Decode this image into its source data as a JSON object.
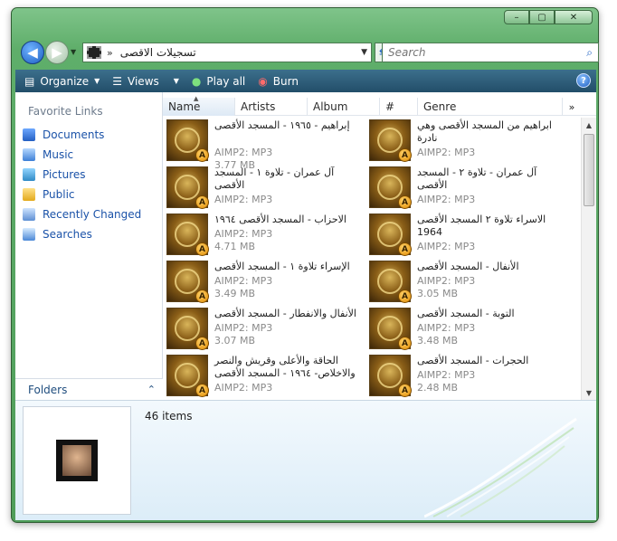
{
  "window": {
    "minimize_glyph": "–",
    "maximize_glyph": "▢",
    "close_glyph": "✕"
  },
  "address": {
    "separator": "»",
    "path": "تسجيلات الاقصى",
    "search_placeholder": "Search"
  },
  "toolbar": {
    "organize": "Organize",
    "views": "Views",
    "play_all": "Play all",
    "burn": "Burn",
    "help_glyph": "?"
  },
  "nav": {
    "favorite_title": "Favorite Links",
    "items": [
      {
        "label": "Documents",
        "icon": "documents-icon"
      },
      {
        "label": "Music",
        "icon": "music-icon"
      },
      {
        "label": "Pictures",
        "icon": "pictures-icon"
      },
      {
        "label": "Public",
        "icon": "public-icon"
      },
      {
        "label": "Recently Changed",
        "icon": "recently-changed-icon"
      },
      {
        "label": "Searches",
        "icon": "searches-icon"
      }
    ],
    "folders_label": "Folders"
  },
  "columns": {
    "name": "Name",
    "artists": "Artists",
    "album": "Album",
    "number": "#",
    "genre": "Genre",
    "more": "»"
  },
  "files": [
    {
      "title": "إبراهيم - ١٩٦٥ - المسجد الأقصى",
      "type": "AIMP2: MP3",
      "size": "3.77 MB"
    },
    {
      "title": "ابراهيم من المسجد الأقصى وهي نادرة",
      "type": "AIMP2: MP3",
      "size": ""
    },
    {
      "title": "آل عمران - تلاوة ١ - المسجد الأقصى",
      "type": "AIMP2: MP3",
      "size": ""
    },
    {
      "title": "آل عمران - تلاوة ٢ - المسجد الأقصى",
      "type": "AIMP2: MP3",
      "size": ""
    },
    {
      "title": "الاحزاب - المسجد الأقصى ١٩٦٤",
      "type": "AIMP2: MP3",
      "size": "4.71 MB"
    },
    {
      "title": "الاسراء تلاوة ٢ المسجد الأقصى 1964",
      "type": "AIMP2: MP3",
      "size": ""
    },
    {
      "title": "الإسراء تلاوة ١ - المسجد الأقصى",
      "type": "AIMP2: MP3",
      "size": "3.49 MB"
    },
    {
      "title": "الأنفال - المسجد الأقصى",
      "type": "AIMP2: MP3",
      "size": "3.05 MB"
    },
    {
      "title": "الأنفال والانفطار - المسجد الأقصى",
      "type": "AIMP2: MP3",
      "size": "3.07 MB"
    },
    {
      "title": "التوبة - المسجد الأقصى",
      "type": "AIMP2: MP3",
      "size": "3.48 MB"
    },
    {
      "title": "الحاقة والأعلى وقريش والنصر والاخلاص- ١٩٦٤ - المسجد الأقصى",
      "type": "AIMP2: MP3",
      "size": ""
    },
    {
      "title": "الحجرات - المسجد الأقصى",
      "type": "AIMP2: MP3",
      "size": "2.48 MB"
    }
  ],
  "details": {
    "item_count": "46 items"
  },
  "colors": {
    "frame_green": "#5fae6a",
    "toolbar_blue": "#2c5a77",
    "link_blue": "#1a52a8"
  }
}
